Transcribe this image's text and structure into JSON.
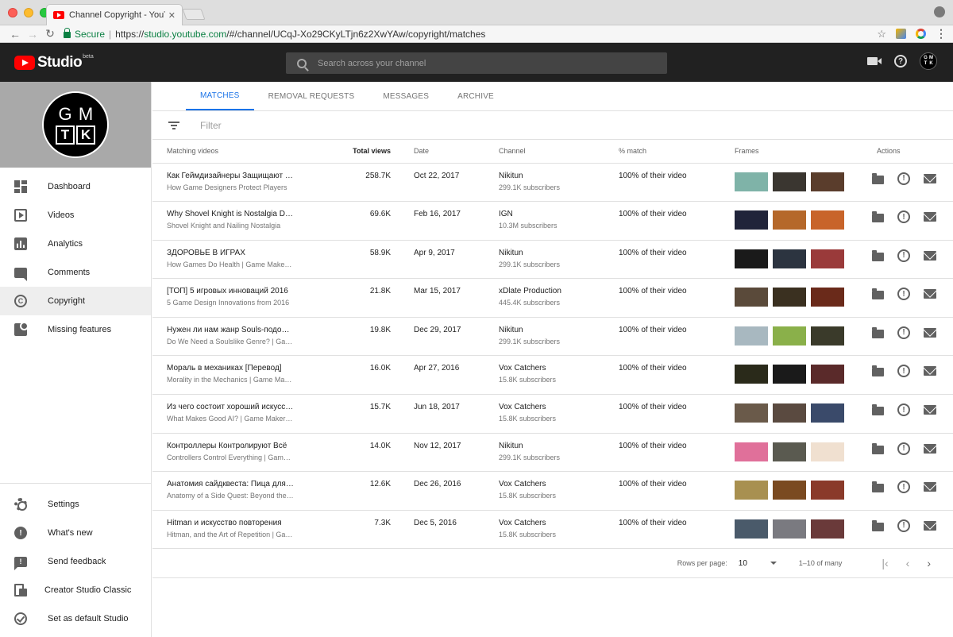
{
  "browser": {
    "tab_title": "Channel Copyright - YouTube Studio",
    "tab_close": "✕",
    "secure_label": "Secure",
    "url_scheme": "https://",
    "url_host": "studio.youtube.com",
    "url_path": "/#/channel/UCqJ-Xo29CKyLTjn6z2XwYAw/copyright/matches"
  },
  "header": {
    "logo_text": "Studio",
    "logo_badge": "beta",
    "search_placeholder": "Search across your channel",
    "avatar_letters": [
      "G",
      "M",
      "T",
      "K"
    ]
  },
  "channel": {
    "avatar_letters": [
      "G",
      "M",
      "T",
      "K"
    ]
  },
  "sidebar": {
    "items": [
      {
        "label": "Dashboard",
        "icon": "dashboard-icon"
      },
      {
        "label": "Videos",
        "icon": "videos-icon"
      },
      {
        "label": "Analytics",
        "icon": "analytics-icon"
      },
      {
        "label": "Comments",
        "icon": "comments-icon"
      },
      {
        "label": "Copyright",
        "icon": "copyright-icon",
        "active": true
      },
      {
        "label": "Missing features",
        "icon": "missing-features-icon"
      }
    ],
    "bottom_items": [
      {
        "label": "Settings",
        "icon": "settings-icon"
      },
      {
        "label": "What's new",
        "icon": "whats-new-icon"
      },
      {
        "label": "Send feedback",
        "icon": "feedback-icon"
      },
      {
        "label": "Creator Studio Classic",
        "icon": "creator-studio-classic-icon"
      },
      {
        "label": "Set as default Studio",
        "icon": "check-circle-icon"
      }
    ]
  },
  "tabs": [
    {
      "label": "MATCHES",
      "active": true
    },
    {
      "label": "REMOVAL REQUESTS"
    },
    {
      "label": "MESSAGES"
    },
    {
      "label": "ARCHIVE"
    }
  ],
  "filter": {
    "placeholder": "Filter"
  },
  "table": {
    "columns": {
      "videos": "Matching videos",
      "views": "Total views",
      "date": "Date",
      "channel": "Channel",
      "match": "% match",
      "frames": "Frames",
      "actions": "Actions"
    },
    "rows": [
      {
        "title": "Как Геймдизайнеры Защищают Игроков",
        "subtitle": "How Game Designers Protect Players",
        "views": "258.7K",
        "date": "Oct 22, 2017",
        "channel": "Nikitun",
        "subs": "299.1K subscribers",
        "match": "100% of their video",
        "frames": [
          "#7fb3a8",
          "#3a3630",
          "#5a3d2c"
        ]
      },
      {
        "title": "Why Shovel Knight is Nostalgia Done Right",
        "subtitle": "Shovel Knight and Nailing Nostalgia",
        "views": "69.6K",
        "date": "Feb 16, 2017",
        "channel": "IGN",
        "subs": "10.3M subscribers",
        "match": "100% of their video",
        "frames": [
          "#20243a",
          "#b5682a",
          "#c8642a"
        ]
      },
      {
        "title": "ЗДОРОВЬЕ В ИГРАХ",
        "subtitle": "How Games Do Health | Game Maker's Toolkit",
        "views": "58.9K",
        "date": "Apr 9, 2017",
        "channel": "Nikitun",
        "subs": "299.1K subscribers",
        "match": "100% of their video",
        "frames": [
          "#1a1a1a",
          "#2c3440",
          "#9a3a3a"
        ]
      },
      {
        "title": "[ТОП] 5 игровых инноваций 2016",
        "subtitle": "5 Game Design Innovations from 2016",
        "views": "21.8K",
        "date": "Mar 15, 2017",
        "channel": "xDlate Production",
        "subs": "445.4K subscribers",
        "match": "100% of their video",
        "frames": [
          "#5a4a3a",
          "#3a3020",
          "#6a2a1a"
        ]
      },
      {
        "title": "Нужен ли нам жанр Souls-подобных игр?",
        "subtitle": "Do We Need a Soulslike Genre? | Game Maker's Toolkit",
        "views": "19.8K",
        "date": "Dec 29, 2017",
        "channel": "Nikitun",
        "subs": "299.1K subscribers",
        "match": "100% of their video",
        "frames": [
          "#a8b8c0",
          "#8ab04a",
          "#3a3a2a"
        ]
      },
      {
        "title": "Мораль в механиках [Перевод]",
        "subtitle": "Morality in the Mechanics | Game Maker's Toolkit",
        "views": "16.0K",
        "date": "Apr 27, 2016",
        "channel": "Vox Catchers",
        "subs": "15.8K subscribers",
        "match": "100% of their video",
        "frames": [
          "#2a2a1a",
          "#1a1a1a",
          "#5a2a2a"
        ]
      },
      {
        "title": "Из чего состоит хороший искусственный интеллект",
        "subtitle": "What Makes Good AI? | Game Maker's Toolkit",
        "views": "15.7K",
        "date": "Jun 18, 2017",
        "channel": "Vox Catchers",
        "subs": "15.8K subscribers",
        "match": "100% of their video",
        "frames": [
          "#6a5a4a",
          "#5a4a40",
          "#3a4a6a"
        ]
      },
      {
        "title": "Контроллеры Контролируют Всё",
        "subtitle": "Controllers Control Everything | Game Maker's Toolkit",
        "views": "14.0K",
        "date": "Nov 12, 2017",
        "channel": "Nikitun",
        "subs": "299.1K subscribers",
        "match": "100% of their video",
        "frames": [
          "#e0709a",
          "#5a5a50",
          "#f0e0d0"
        ]
      },
      {
        "title": "Анатомия сайдквеста: Пица для Ведьмака",
        "subtitle": "Anatomy of a Side Quest: Beyond the Witcher",
        "views": "12.6K",
        "date": "Dec 26, 2016",
        "channel": "Vox Catchers",
        "subs": "15.8K subscribers",
        "match": "100% of their video",
        "frames": [
          "#a89050",
          "#7a4a20",
          "#8a3a2a"
        ]
      },
      {
        "title": "Hitman и искусство повторения",
        "subtitle": "Hitman, and the Art of Repetition | Game Maker's Toolkit",
        "views": "7.3K",
        "date": "Dec 5, 2016",
        "channel": "Vox Catchers",
        "subs": "15.8K subscribers",
        "match": "100% of their video",
        "frames": [
          "#4a5a6a",
          "#7a7a80",
          "#6a3a3a"
        ]
      }
    ]
  },
  "pager": {
    "rows_label": "Rows per page:",
    "rows_value": "10",
    "range": "1–10 of many"
  }
}
